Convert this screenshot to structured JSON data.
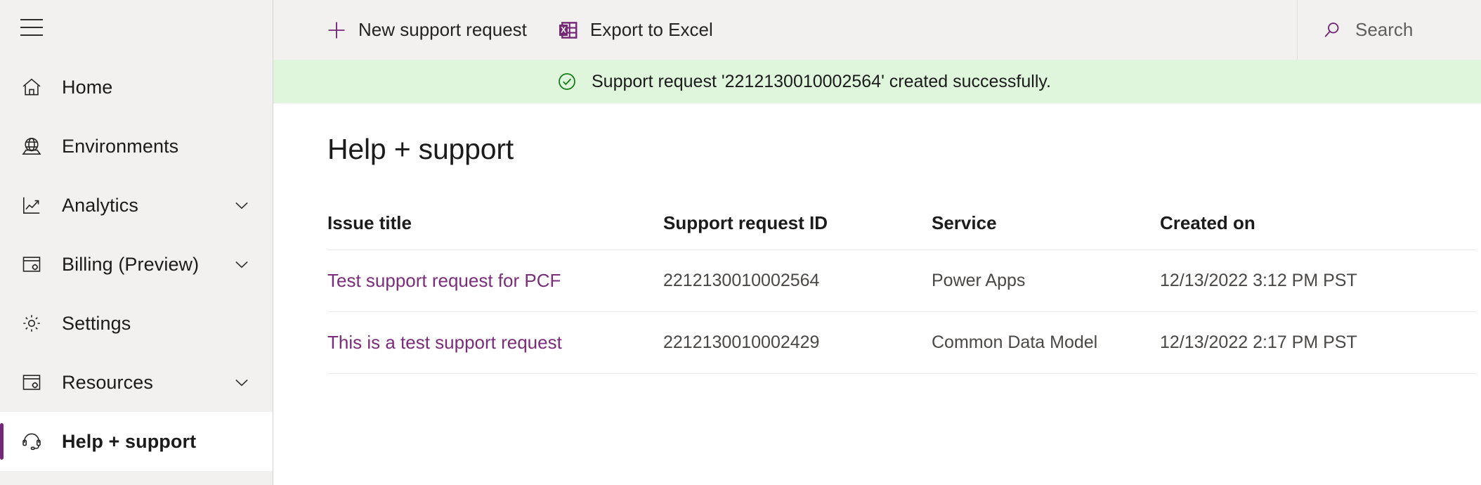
{
  "sidebar": {
    "menu_button": "hamburger-menu",
    "items": [
      {
        "label": "Home",
        "icon": "home-icon",
        "expandable": false,
        "selected": false
      },
      {
        "label": "Environments",
        "icon": "globe-icon",
        "expandable": false,
        "selected": false
      },
      {
        "label": "Analytics",
        "icon": "analytics-icon",
        "expandable": true,
        "selected": false
      },
      {
        "label": "Billing (Preview)",
        "icon": "billing-icon",
        "expandable": true,
        "selected": false
      },
      {
        "label": "Settings",
        "icon": "gear-icon",
        "expandable": false,
        "selected": false
      },
      {
        "label": "Resources",
        "icon": "resources-icon",
        "expandable": true,
        "selected": false
      },
      {
        "label": "Help + support",
        "icon": "headset-icon",
        "expandable": false,
        "selected": true
      }
    ]
  },
  "commandbar": {
    "new_request_label": "New support request",
    "new_request_icon": "plus-icon",
    "export_label": "Export to Excel",
    "export_icon": "excel-icon"
  },
  "search": {
    "placeholder": "Search",
    "icon": "search-icon",
    "value": ""
  },
  "notification": {
    "icon": "success-check-icon",
    "message": "Support request '2212130010002564' created successfully."
  },
  "page": {
    "title": "Help + support"
  },
  "table": {
    "columns": [
      "Issue title",
      "Support request ID",
      "Service",
      "Created on"
    ],
    "rows": [
      {
        "issue_title": "Test support request for PCF",
        "request_id": "2212130010002564",
        "service": "Power Apps",
        "created_on": "12/13/2022 3:12 PM PST"
      },
      {
        "issue_title": "This is a test support request",
        "request_id": "2212130010002429",
        "service": "Common Data Model",
        "created_on": "12/13/2022 2:17 PM PST"
      }
    ]
  },
  "colors": {
    "accent_purple": "#742774",
    "link_purple": "#7b2d7b",
    "success_green_bg": "#dff6dd",
    "success_green_fg": "#107c10",
    "chrome_gray": "#f2f1f0"
  }
}
